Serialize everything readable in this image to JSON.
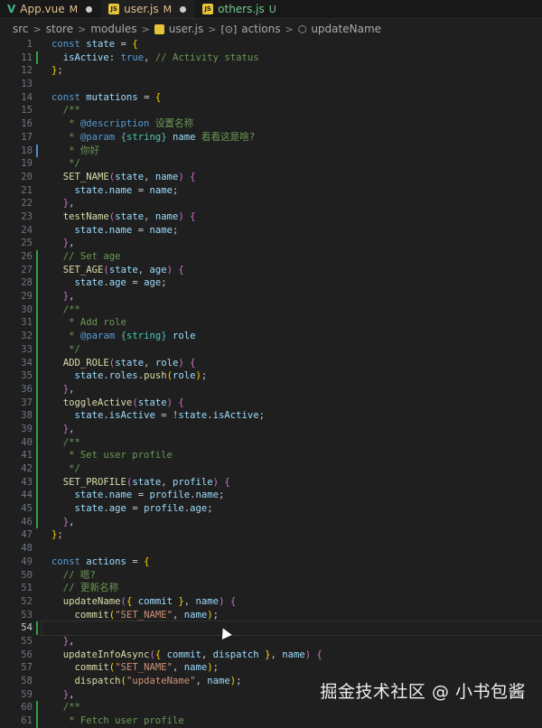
{
  "tabs": [
    {
      "name": "App.vue",
      "status": "M",
      "icon": "vue-icon",
      "dirty": true
    },
    {
      "name": "user.js",
      "status": "M",
      "icon": "js-icon",
      "dirty": true,
      "active": true
    },
    {
      "name": "others.js",
      "status": "U",
      "icon": "js-icon",
      "dirty": false
    }
  ],
  "breadcrumb": {
    "items": [
      "src",
      "store",
      "modules",
      "user.js",
      "actions",
      "updateName"
    ]
  },
  "code_lines": [
    {
      "n": "1",
      "html": "<span class='k'>const</span> <span class='v'>state</span> = <span class='y'>{</span>",
      "g": ""
    },
    {
      "n": "11",
      "html": "  <span class='v'>isActive</span>: <span class='k'>true</span>, <span class='c'>// Activity status</span>",
      "g": "add"
    },
    {
      "n": "12",
      "html": "<span class='y'>}</span>;",
      "g": ""
    },
    {
      "n": "13",
      "html": "",
      "g": ""
    },
    {
      "n": "14",
      "html": "<span class='k'>const</span> <span class='v'>mutations</span> = <span class='y'>{</span>",
      "g": ""
    },
    {
      "n": "15",
      "html": "  <span class='c'>/**</span>",
      "g": ""
    },
    {
      "n": "16",
      "html": "<span class='c'>   * </span><span class='dk'>@description</span><span class='c'> 设置名称</span>",
      "g": ""
    },
    {
      "n": "17",
      "html": "<span class='c'>   * </span><span class='dk'>@param</span><span class='c'> </span><span class='dt'>{string}</span><span class='c'> </span><span class='v'>name</span><span class='c'> 看看这是啥?</span>",
      "g": ""
    },
    {
      "n": "18",
      "html": "<span class='c'>   * 你好</span>",
      "g": "mod"
    },
    {
      "n": "19",
      "html": "<span class='c'>   */</span>",
      "g": ""
    },
    {
      "n": "20",
      "html": "  <span class='f'>SET_NAME</span><span class='p'>(</span><span class='v'>state</span>, <span class='v'>name</span><span class='p'>)</span> <span class='p'>{</span>",
      "g": ""
    },
    {
      "n": "21",
      "html": "    <span class='v'>state</span>.<span class='v'>name</span> = <span class='v'>name</span>;",
      "g": ""
    },
    {
      "n": "22",
      "html": "  <span class='p'>}</span>,",
      "g": ""
    },
    {
      "n": "23",
      "html": "  <span class='f'>testName</span><span class='p'>(</span><span class='v'>state</span>, <span class='v'>name</span><span class='p'>)</span> <span class='p'>{</span>",
      "g": ""
    },
    {
      "n": "24",
      "html": "    <span class='v'>state</span>.<span class='v'>name</span> = <span class='v'>name</span>;",
      "g": ""
    },
    {
      "n": "25",
      "html": "  <span class='p'>}</span>,",
      "g": ""
    },
    {
      "n": "26",
      "html": "  <span class='c'>// Set age</span>",
      "g": "add"
    },
    {
      "n": "27",
      "html": "  <span class='f'>SET_AGE</span><span class='p'>(</span><span class='v'>state</span>, <span class='v'>age</span><span class='p'>)</span> <span class='p'>{</span>",
      "g": "add"
    },
    {
      "n": "28",
      "html": "    <span class='v'>state</span>.<span class='v'>age</span> = <span class='v'>age</span>;",
      "g": "add"
    },
    {
      "n": "29",
      "html": "  <span class='p'>}</span>,",
      "g": "add"
    },
    {
      "n": "30",
      "html": "  <span class='c'>/**</span>",
      "g": "add"
    },
    {
      "n": "31",
      "html": "<span class='c'>   * Add role</span>",
      "g": "add"
    },
    {
      "n": "32",
      "html": "<span class='c'>   * </span><span class='dk'>@param</span><span class='c'> </span><span class='dt'>{string}</span><span class='c'> </span><span class='v'>role</span>",
      "g": "add"
    },
    {
      "n": "33",
      "html": "<span class='c'>   */</span>",
      "g": "add"
    },
    {
      "n": "34",
      "html": "  <span class='f'>ADD_ROLE</span><span class='p'>(</span><span class='v'>state</span>, <span class='v'>role</span><span class='p'>)</span> <span class='p'>{</span>",
      "g": "add"
    },
    {
      "n": "35",
      "html": "    <span class='v'>state</span>.<span class='v'>roles</span>.<span class='f'>push</span><span class='y'>(</span><span class='v'>role</span><span class='y'>)</span>;",
      "g": "add"
    },
    {
      "n": "36",
      "html": "  <span class='p'>}</span>,",
      "g": "add"
    },
    {
      "n": "37",
      "html": "  <span class='f'>toggleActive</span><span class='p'>(</span><span class='v'>state</span><span class='p'>)</span> <span class='p'>{</span>",
      "g": "add"
    },
    {
      "n": "38",
      "html": "    <span class='v'>state</span>.<span class='v'>isActive</span> = !<span class='v'>state</span>.<span class='v'>isActive</span>;",
      "g": "add"
    },
    {
      "n": "39",
      "html": "  <span class='p'>}</span>,",
      "g": "add"
    },
    {
      "n": "40",
      "html": "  <span class='c'>/**</span>",
      "g": "add"
    },
    {
      "n": "41",
      "html": "<span class='c'>   * Set user profile</span>",
      "g": "add"
    },
    {
      "n": "42",
      "html": "<span class='c'>   */</span>",
      "g": "add"
    },
    {
      "n": "43",
      "html": "  <span class='f'>SET_PROFILE</span><span class='p'>(</span><span class='v'>state</span>, <span class='v'>profile</span><span class='p'>)</span> <span class='p'>{</span>",
      "g": "add"
    },
    {
      "n": "44",
      "html": "    <span class='v'>state</span>.<span class='v'>name</span> = <span class='v'>profile</span>.<span class='v'>name</span>;",
      "g": "add"
    },
    {
      "n": "45",
      "html": "    <span class='v'>state</span>.<span class='v'>age</span> = <span class='v'>profile</span>.<span class='v'>age</span>;",
      "g": "add"
    },
    {
      "n": "46",
      "html": "  <span class='p'>}</span>,",
      "g": "add"
    },
    {
      "n": "47",
      "html": "<span class='y'>}</span>;",
      "g": ""
    },
    {
      "n": "48",
      "html": "",
      "g": ""
    },
    {
      "n": "49",
      "html": "<span class='k'>const</span> <span class='v'>actions</span> = <span class='y'>{</span>",
      "g": ""
    },
    {
      "n": "50",
      "html": "  <span class='c'>// 嗯?</span>",
      "g": ""
    },
    {
      "n": "51",
      "html": "  <span class='c'>// 更新名称</span>",
      "g": ""
    },
    {
      "n": "52",
      "html": "  <span class='f'>updateName</span><span class='p'>(</span><span class='y'>{</span> <span class='v'>commit</span> <span class='y'>}</span>, <span class='v'>name</span><span class='p'>)</span> <span class='p'>{</span>",
      "g": ""
    },
    {
      "n": "53",
      "html": "    <span class='f'>commit</span><span class='y'>(</span><span class='s'>\"SET_NAME\"</span>, <span class='v'>name</span><span class='y'>)</span>;",
      "g": ""
    },
    {
      "n": "54",
      "html": "    ",
      "g": "add",
      "current": true
    },
    {
      "n": "55",
      "html": "  <span class='p'>}</span>,",
      "g": ""
    },
    {
      "n": "56",
      "html": "  <span class='f'>updateInfoAsync</span><span class='p'>(</span><span class='y'>{</span> <span class='v'>commit</span>, <span class='v'>dispatch</span> <span class='y'>}</span>, <span class='v'>name</span><span class='p'>)</span> <span class='p'>{</span>",
      "g": ""
    },
    {
      "n": "57",
      "html": "    <span class='f'>commit</span><span class='y'>(</span><span class='s'>\"SET_NAME\"</span>, <span class='v'>name</span><span class='y'>)</span>;",
      "g": ""
    },
    {
      "n": "58",
      "html": "    <span class='f'>dispatch</span><span class='y'>(</span><span class='s'>\"updateName\"</span>, <span class='v'>name</span><span class='y'>)</span>;",
      "g": ""
    },
    {
      "n": "59",
      "html": "  <span class='p'>}</span>,",
      "g": ""
    },
    {
      "n": "60",
      "html": "  <span class='c'>/**</span>",
      "g": "add"
    },
    {
      "n": "61",
      "html": "<span class='c'>   * Fetch user profile</span>",
      "g": "add"
    }
  ],
  "watermark": "掘金技术社区 @ 小书包酱",
  "colors": {
    "background": "#1f1f1f",
    "added_gutter": "#2ea043",
    "modified_gutter": "#4c8dcb"
  }
}
